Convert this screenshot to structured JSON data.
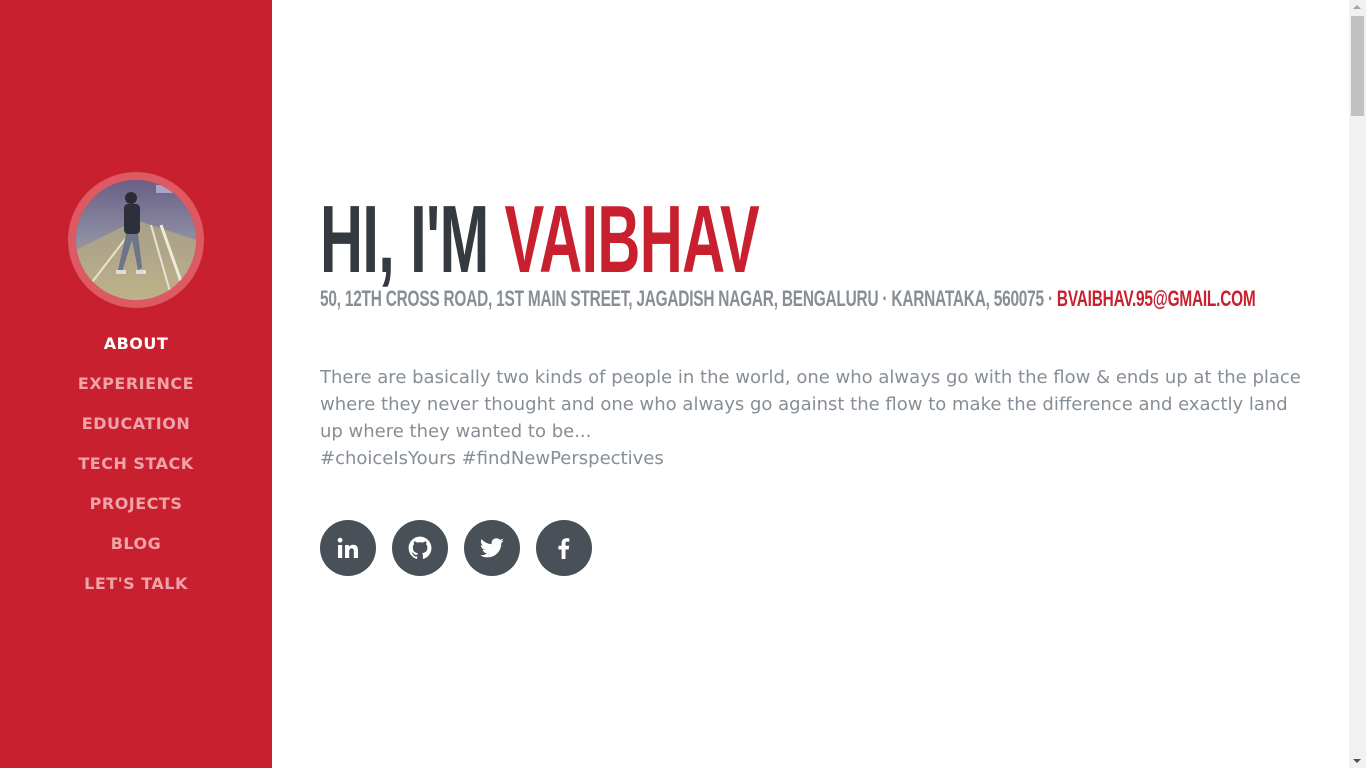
{
  "nav": {
    "items": [
      {
        "label": "ABOUT",
        "active": true
      },
      {
        "label": "EXPERIENCE",
        "active": false
      },
      {
        "label": "EDUCATION",
        "active": false
      },
      {
        "label": "TECH STACK",
        "active": false
      },
      {
        "label": "PROJECTS",
        "active": false
      },
      {
        "label": "BLOG",
        "active": false
      },
      {
        "label": "LET'S TALK",
        "active": false
      }
    ]
  },
  "about": {
    "greeting": "HI, I'M",
    "name": "VAIBHAV",
    "address": "50, 12TH CROSS ROAD, 1ST MAIN STREET, JAGADISH NAGAR, BENGALURU · KARNATAKA, 560075 ·",
    "email": "BVAIBHAV.95@GMAIL.COM",
    "lead": "There are basically two kinds of people in the world, one who always go with the flow & ends up at the place where they never thought and one who always go against the flow to make the difference and exactly land up where they wanted to be...",
    "hashtags": "#choiceIsYours #findNewPerspectives"
  },
  "social": [
    {
      "icon": "linkedin-icon"
    },
    {
      "icon": "github-icon"
    },
    {
      "icon": "twitter-icon"
    },
    {
      "icon": "facebook-icon"
    }
  ],
  "colors": {
    "primary": "#c8202e",
    "heading": "#343a40",
    "muted": "#868e96",
    "social_bg": "#495057"
  }
}
